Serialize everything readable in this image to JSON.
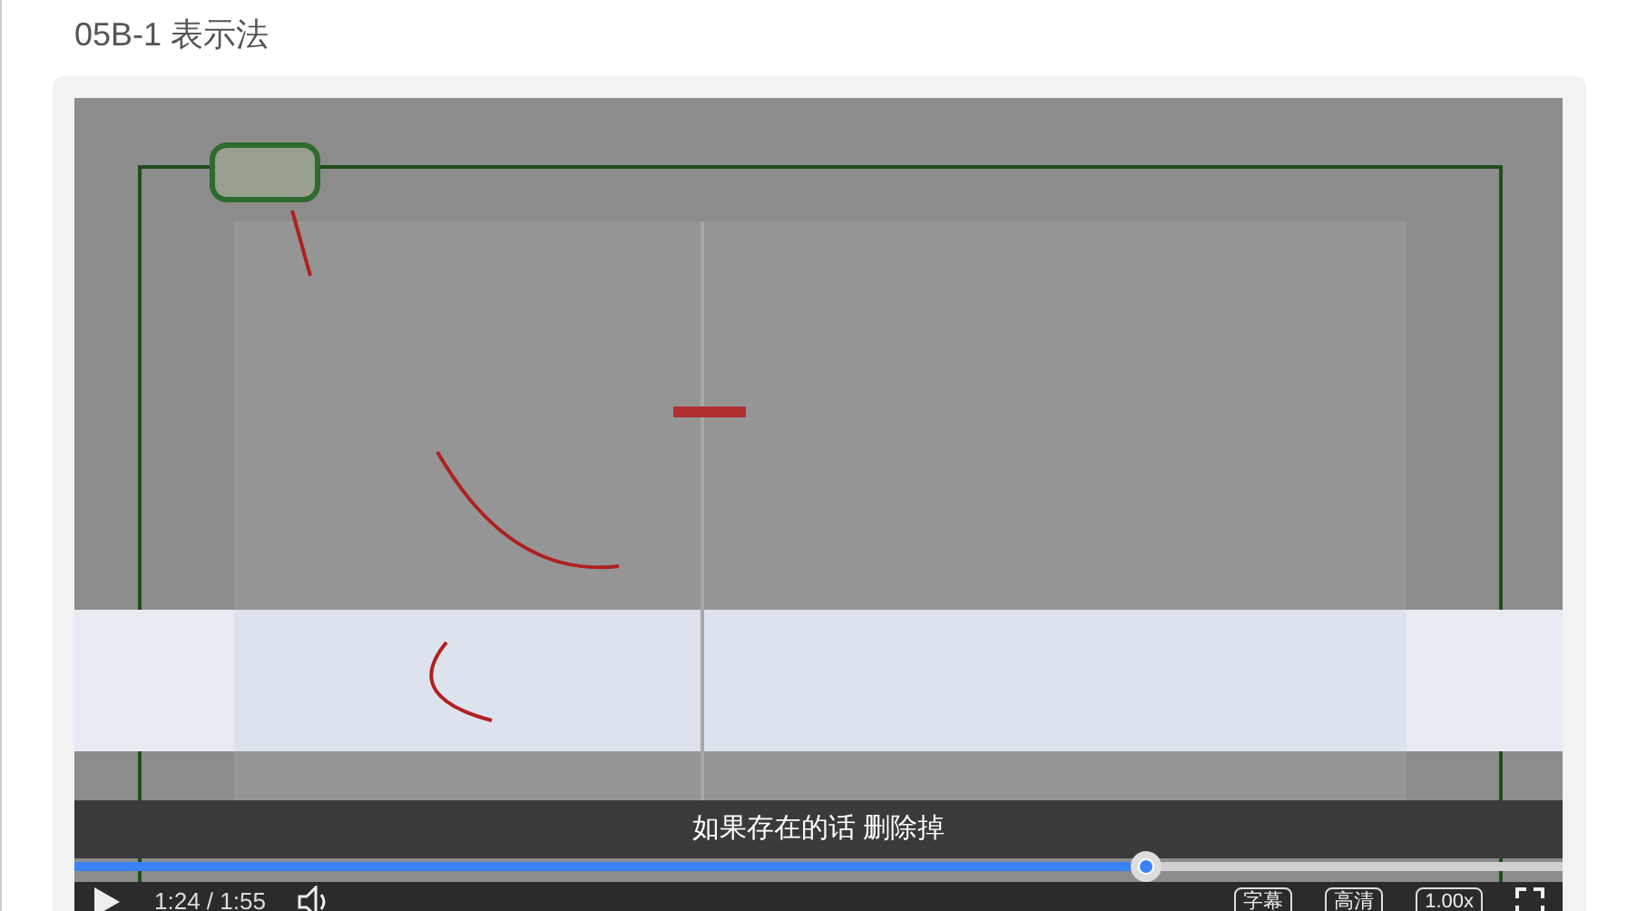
{
  "title": "05B-1 表示法",
  "video": {
    "kind": "picture",
    "subtitle": "如果存在的话 删除掉",
    "progress": {
      "level": 0.72
    },
    "time": "1:24 / 1:55",
    "buttons": [
      {
        "label": "字幕"
      },
      {
        "label": "高清"
      },
      {
        "label": "1.00x"
      }
    ]
  }
}
